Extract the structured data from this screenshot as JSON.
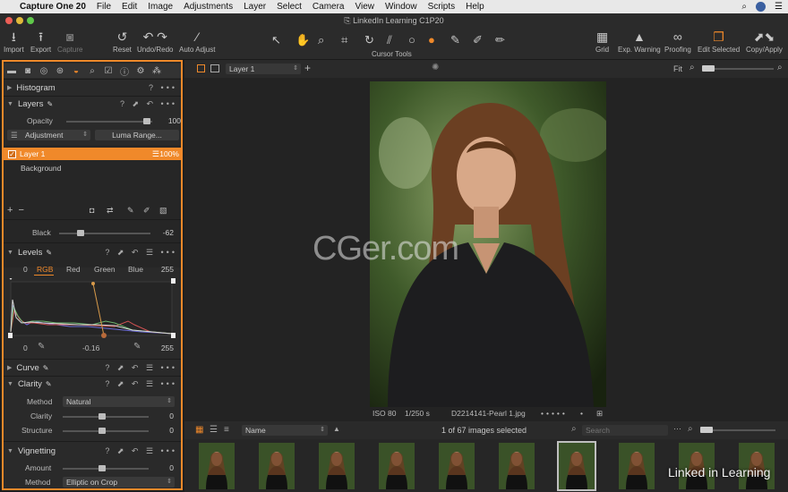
{
  "menubar": {
    "app": "Capture One 20",
    "items": [
      "File",
      "Edit",
      "Image",
      "Adjustments",
      "Layer",
      "Select",
      "Camera",
      "View",
      "Window",
      "Scripts",
      "Help"
    ]
  },
  "window": {
    "title": "LinkedIn Learning C1P20"
  },
  "toolbar": {
    "import": "Import",
    "export": "Export",
    "capture": "Capture",
    "reset": "Reset",
    "undo_redo": "Undo/Redo",
    "auto_adjust": "Auto Adjust",
    "cursor_tools": "Cursor Tools",
    "grid": "Grid",
    "exp_warning": "Exp. Warning",
    "proofing": "Proofing",
    "edit_selected": "Edit Selected",
    "copy_apply": "Copy/Apply"
  },
  "panel": {
    "histogram": {
      "title": "Histogram"
    },
    "layers": {
      "title": "Layers",
      "opacity_label": "Opacity",
      "opacity_value": "100",
      "adjustment_label": "Adjustment",
      "luma_label": "Luma Range...",
      "layer1_name": "Layer 1",
      "layer1_opacity": "100%",
      "background_name": "Background"
    },
    "black": {
      "label": "Black",
      "value": "-62"
    },
    "levels": {
      "title": "Levels",
      "left_value": "0",
      "right_value": "255",
      "channels": [
        "RGB",
        "Red",
        "Green",
        "Blue"
      ],
      "active_channel": "RGB",
      "bottom_left": "0",
      "midtone": "-0.16",
      "bottom_right": "255"
    },
    "curve": {
      "title": "Curve"
    },
    "clarity": {
      "title": "Clarity",
      "method_label": "Method",
      "method_value": "Natural",
      "clarity_label": "Clarity",
      "clarity_value": "0",
      "structure_label": "Structure",
      "structure_value": "0"
    },
    "vignetting": {
      "title": "Vignetting",
      "amount_label": "Amount",
      "amount_value": "0",
      "method_label": "Method",
      "method_value": "Elliptic on Crop"
    }
  },
  "viewer": {
    "layer_select": "Layer 1",
    "fit": "Fit",
    "watermark": "CGer.com",
    "iso": "ISO 80",
    "shutter": "1/250 s",
    "filename": "D2214141-Pearl 1.jpg"
  },
  "browser": {
    "sort": "Name",
    "count": "1 of 67 images selected",
    "search_placeholder": "Search"
  },
  "branding": {
    "linkedin": "Linked in Learning"
  },
  "colors": {
    "accent": "#f0892a"
  }
}
